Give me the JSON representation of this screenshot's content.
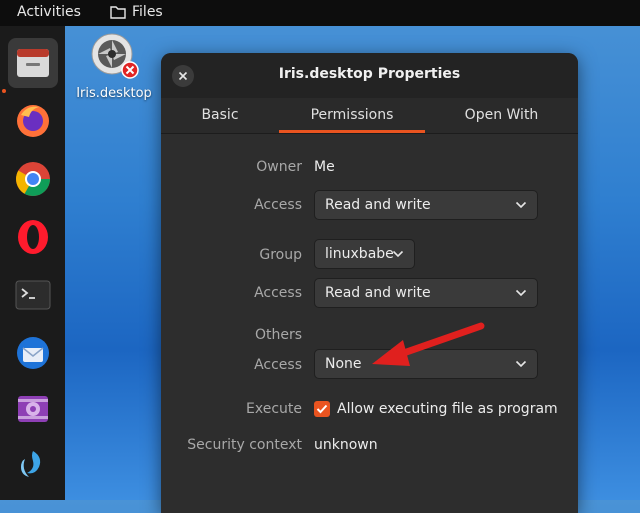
{
  "topbar": {
    "activities": "Activities",
    "files_app": "Files"
  },
  "desktop": {
    "icon_label": "Iris.desktop"
  },
  "dialog": {
    "title": "Iris.desktop Properties",
    "tabs": [
      {
        "label": "Basic"
      },
      {
        "label": "Permissions"
      },
      {
        "label": "Open With"
      }
    ],
    "selected_tab": "Permissions",
    "owner": {
      "label": "Owner",
      "value": "Me",
      "access_label": "Access",
      "access_value": "Read and write"
    },
    "group": {
      "label": "Group",
      "value": "linuxbabe",
      "access_label": "Access",
      "access_value": "Read and write"
    },
    "others": {
      "label": "Others",
      "access_label": "Access",
      "access_value": "None"
    },
    "execute": {
      "label": "Execute",
      "checkbox_label": "Allow executing file as program",
      "checked": true
    },
    "security": {
      "label": "Security context",
      "value": "unknown"
    }
  },
  "dock": {
    "items": [
      "files-icon",
      "firefox-icon",
      "chrome-icon",
      "opera-icon",
      "terminal-icon",
      "thunderbird-icon",
      "video-editor-icon",
      "app-icon"
    ]
  },
  "colors": {
    "accent": "#e95420",
    "dialog_bg": "#2d2d2d",
    "annotation_arrow": "#e0201e"
  }
}
